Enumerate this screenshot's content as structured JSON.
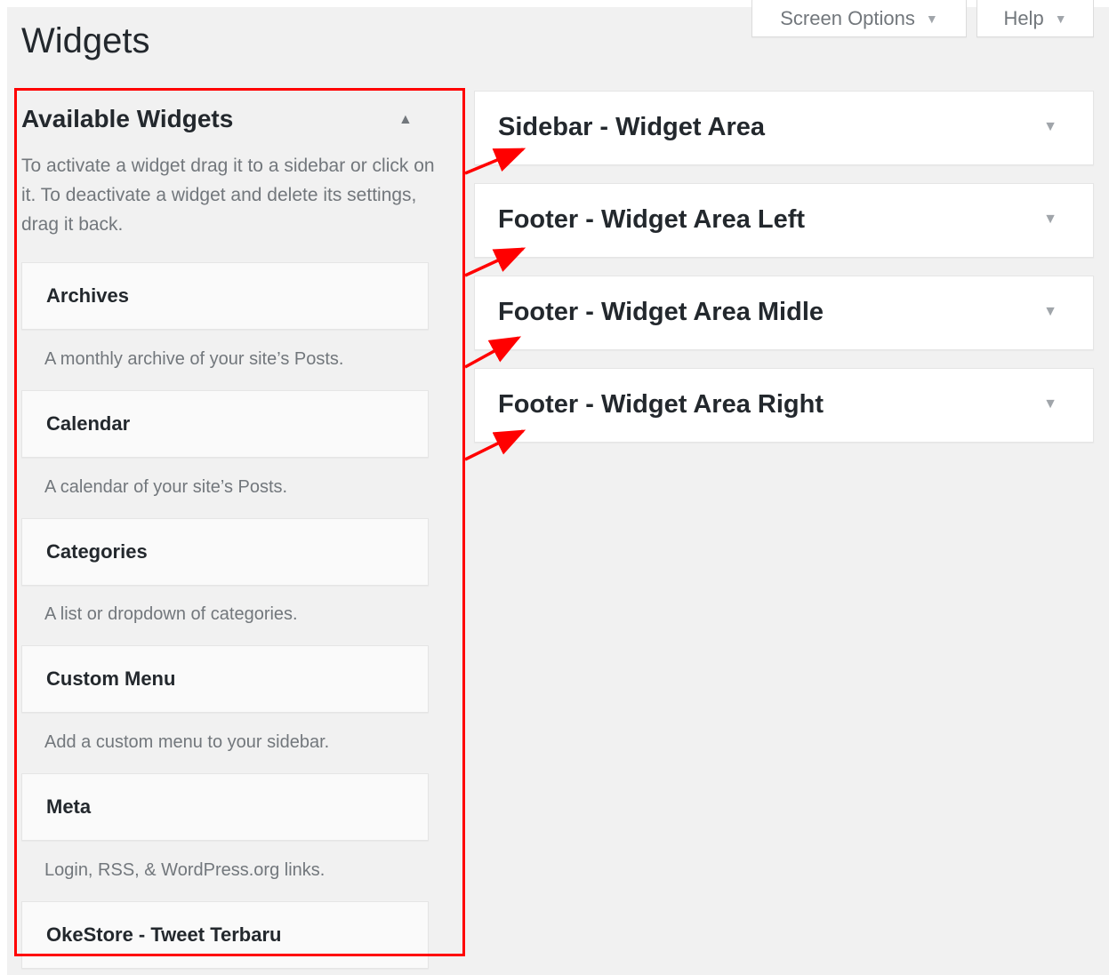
{
  "header": {
    "title": "Widgets",
    "screen_options_label": "Screen Options",
    "help_label": "Help",
    "dropdown_arrow": "▼"
  },
  "available": {
    "title": "Available Widgets",
    "collapse_arrow": "▲",
    "description": "To activate a widget drag it to a sidebar or click on it. To deactivate a widget and delete its settings, drag it back.",
    "widgets": [
      {
        "title": "Archives",
        "description": "A monthly archive of your site’s Posts."
      },
      {
        "title": "Calendar",
        "description": "A calendar of your site’s Posts."
      },
      {
        "title": "Categories",
        "description": "A list or dropdown of categories."
      },
      {
        "title": "Custom Menu",
        "description": "Add a custom menu to your sidebar."
      },
      {
        "title": "Meta",
        "description": "Login, RSS, & WordPress.org links."
      },
      {
        "title": "OkeStore - Tweet Terbaru",
        "description": ""
      }
    ]
  },
  "sidebars": [
    {
      "title": "Sidebar - Widget Area",
      "arrow": "▼"
    },
    {
      "title": "Footer - Widget Area Left",
      "arrow": "▼"
    },
    {
      "title": "Footer - Widget Area Midle",
      "arrow": "▼"
    },
    {
      "title": "Footer - Widget Area Right",
      "arrow": "▼"
    }
  ],
  "annotation": {
    "color": "#ff0000"
  }
}
